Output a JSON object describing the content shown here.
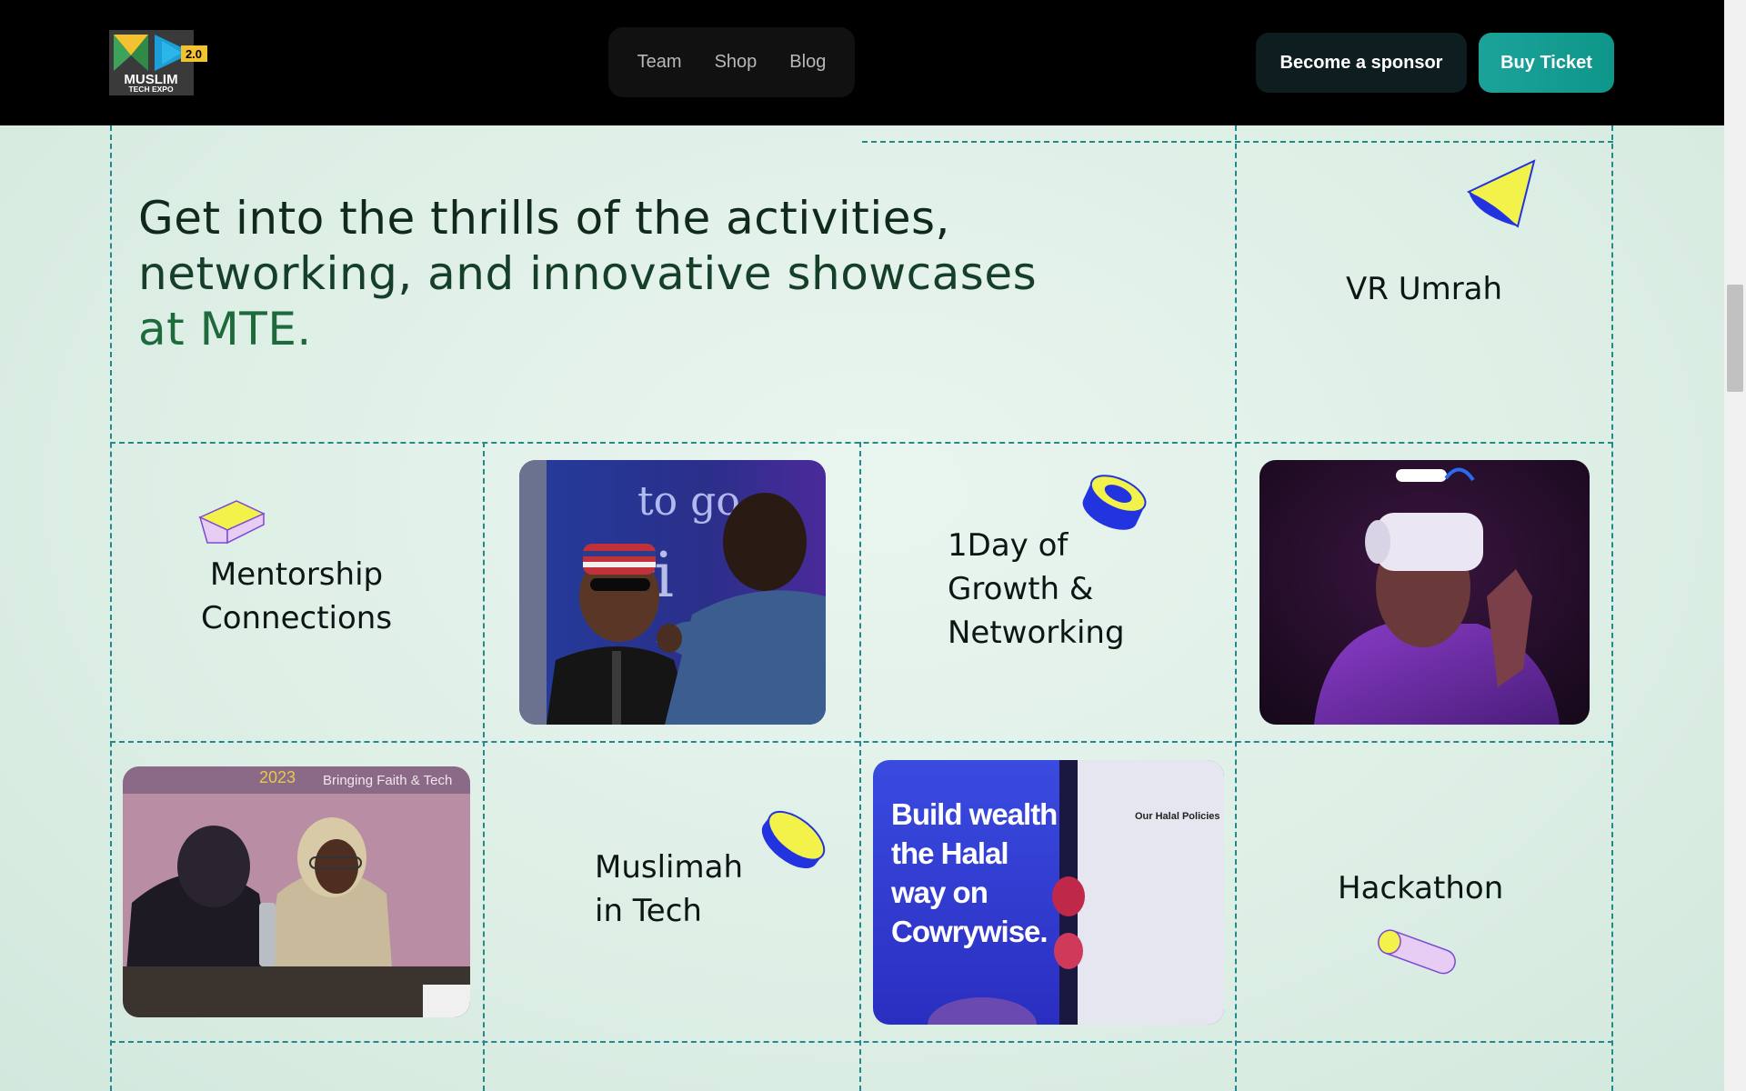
{
  "header": {
    "logo": {
      "line1": "2.0",
      "line2": "MUSLIM",
      "line3": "TECH EXPO"
    },
    "nav": [
      "Team",
      "Shop",
      "Blog"
    ],
    "sponsor_button": "Become a sponsor",
    "ticket_button": "Buy Ticket"
  },
  "hero": {
    "line1": "Get into the thrills of the activities,",
    "line2": "networking, and innovative showcases",
    "line3": "at MTE."
  },
  "features": {
    "vr_umrah": "VR Umrah",
    "mentorship_1": "Mentorship",
    "mentorship_2": "Connections",
    "growth_1": "1Day of",
    "growth_2": "Growth &",
    "growth_3": "Networking",
    "muslimah_1": "Muslimah",
    "muslimah_2": "in Tech",
    "hackathon": "Hackathon"
  },
  "photos": {
    "cowrywise_1": "Build wealth",
    "cowrywise_2": "the Halal",
    "cowrywise_3": "way on",
    "cowrywise_4": "Cowrywise.",
    "cowrywise_panel": "Our Halal Policies"
  },
  "colors": {
    "header_bg": "#000000",
    "accent_teal": "#1ba39a",
    "grid_line": "#24898a",
    "shape_yellow": "#f2f24a",
    "shape_blue": "#2233e0",
    "shape_lilac": "#e7ccf3"
  }
}
